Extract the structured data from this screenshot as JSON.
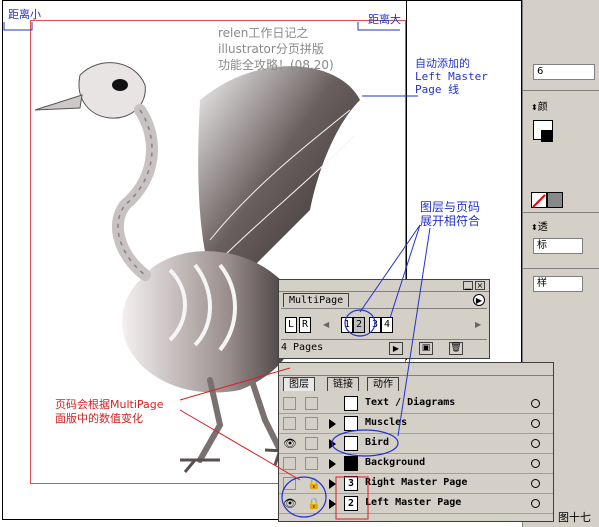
{
  "annotations": {
    "margin_small": "距离小",
    "margin_large": "距离大",
    "title_line1": "relen工作日记之",
    "title_line2": "illustrator分页拼版",
    "title_line3": "功能全攻略！(08.20)",
    "auto_added_1": "自动添加的",
    "auto_added_2": "Left Master",
    "auto_added_3": "Page 线",
    "layers_match_1": "图层与页码",
    "layers_match_2": "展开相符合",
    "page_numbers_1": "页码会根据MultiPage",
    "page_numbers_2": "面版中的数值变化",
    "figure_label": "图十七"
  },
  "tool_strip": {
    "field_top": "6",
    "item_1": "颜",
    "item_2": "透",
    "item_3": "标",
    "item_4": "样"
  },
  "multipage": {
    "title": "MultiPage",
    "masters": [
      "L",
      "R"
    ],
    "pages": [
      "1",
      "2",
      "3",
      "4"
    ],
    "status": "4 Pages"
  },
  "layers_panel": {
    "tabs": [
      "图层",
      "链接",
      "动作"
    ],
    "layers": [
      {
        "name": "Text / Diagrams",
        "thumb": "",
        "visible": false,
        "locked": false
      },
      {
        "name": "Muscles",
        "thumb": "",
        "visible": false,
        "locked": false
      },
      {
        "name": "Bird",
        "thumb": "",
        "visible": true,
        "locked": false
      },
      {
        "name": "Background",
        "thumb": "",
        "visible": false,
        "locked": false
      },
      {
        "name": "Right Master Page",
        "thumb": "3",
        "visible": false,
        "locked": true
      },
      {
        "name": "Left Master Page",
        "thumb": "2",
        "visible": true,
        "locked": true
      }
    ]
  },
  "colors": {
    "annotation_blue": "#2233cc",
    "annotation_red": "#d62020",
    "panel_gray": "#d4d0c8"
  }
}
